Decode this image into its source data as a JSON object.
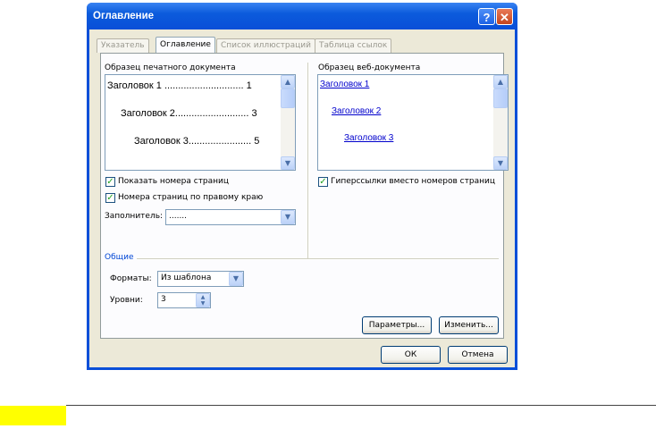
{
  "dialog": {
    "title": "Оглавление",
    "help_glyph": "?",
    "close_glyph": "✕"
  },
  "tabs": [
    {
      "label": "Указатель"
    },
    {
      "label": "Оглавление"
    },
    {
      "label": "Список иллюстраций"
    },
    {
      "label": "Таблица ссылок"
    }
  ],
  "print_preview": {
    "label": "Образец печатного документа",
    "lines": [
      {
        "text": "Заголовок 1 ............................. 1"
      },
      {
        "text": "Заголовок 2........................... 3"
      },
      {
        "text": "Заголовок 3....................... 5"
      }
    ]
  },
  "web_preview": {
    "label": "Образец веб-документа",
    "links": [
      "Заголовок 1",
      "Заголовок 2",
      "Заголовок 3"
    ]
  },
  "options": {
    "show_page_numbers": {
      "label": "Показать номера страниц",
      "checked": true
    },
    "right_align": {
      "label": "Номера страниц по правому краю",
      "checked": true
    },
    "hyperlinks": {
      "label": "Гиперссылки вместо номеров страниц",
      "checked": true
    },
    "leader_label": "Заполнитель:",
    "leader_value": "......."
  },
  "general": {
    "title": "Общие",
    "formats_label": "Форматы:",
    "formats_value": "Из шаблона",
    "levels_label": "Уровни:",
    "levels_value": "3"
  },
  "buttons": {
    "parameters": "Параметры...",
    "modify": "Изменить...",
    "ok": "ОК",
    "cancel": "Отмена"
  },
  "glyphs": {
    "up": "▲",
    "down": "▼",
    "check": "✓"
  }
}
